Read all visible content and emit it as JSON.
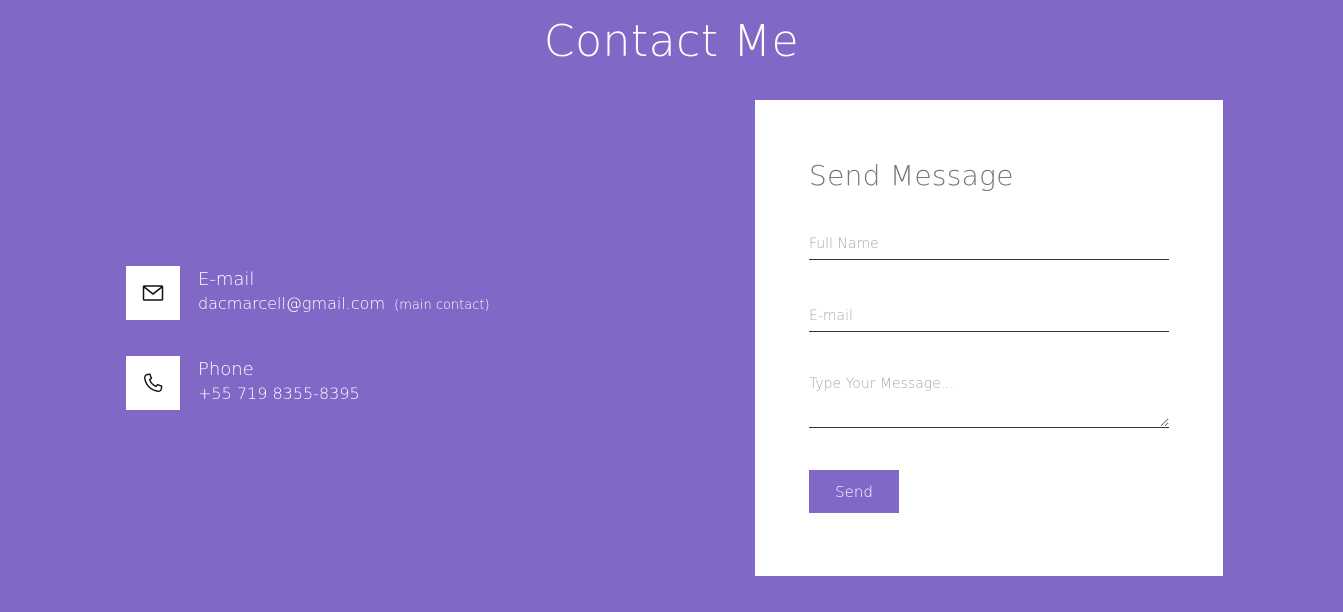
{
  "page": {
    "title": "Contact Me",
    "background_color": "#8167c6"
  },
  "contact": {
    "email": {
      "icon": "envelope-icon",
      "label": "E-mail",
      "value": "dacmarcell@gmail.com",
      "note": "(main contact)"
    },
    "phone": {
      "icon": "phone-icon",
      "label": "Phone",
      "value": "+55 719 8355-8395"
    }
  },
  "form": {
    "title": "Send Message",
    "full_name": {
      "placeholder": "Full Name",
      "value": ""
    },
    "email": {
      "placeholder": "E-mail",
      "value": ""
    },
    "message": {
      "placeholder": "Type Your Message...",
      "value": ""
    },
    "send_label": "Send",
    "accent_color": "#8167c6"
  }
}
